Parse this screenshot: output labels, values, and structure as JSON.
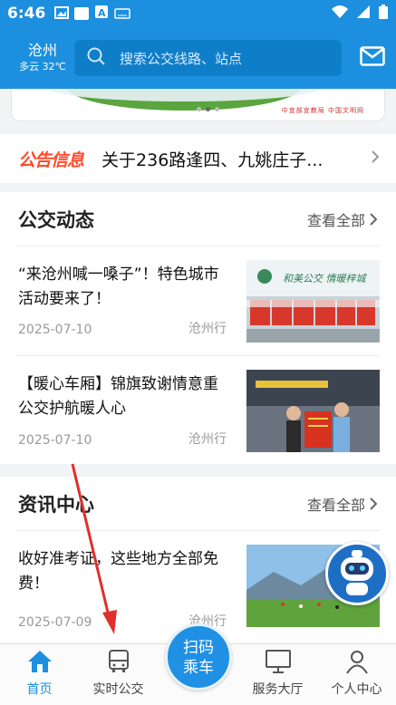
{
  "status_bar": {
    "time": "6:46"
  },
  "header": {
    "city": "沧州",
    "weather": "多云 32℃",
    "search_placeholder": "搜索公交线路、站点"
  },
  "banner": {
    "credits": "中宣部宣教局  中国文明网"
  },
  "notice": {
    "tag": "公告信息",
    "text": "关于236路逢四、九姚庄子..."
  },
  "bus_news": {
    "title": "公交动态",
    "more": "查看全部",
    "items": [
      {
        "title": "“来沧州喊一嗓子”！特色城市活动要来了！",
        "date": "2025-07-10",
        "source": "沧州行",
        "thumb_caption": "和美公交 情暖梓城"
      },
      {
        "title": "【暖心车厢】锦旗致谢情意重 公交护航暖人心",
        "date": "2025-07-10",
        "source": "沧州行"
      }
    ]
  },
  "info_center": {
    "title": "资讯中心",
    "more": "查看全部",
    "items": [
      {
        "title": "收好准考证，这些地方全部免费！",
        "date": "2025-07-09",
        "source": "沧州行"
      }
    ]
  },
  "bottom_nav": {
    "items": [
      {
        "label": "首页",
        "icon": "home-icon"
      },
      {
        "label": "实时公交",
        "icon": "bus-icon"
      },
      {
        "label": "服务大厅",
        "icon": "monitor-icon"
      },
      {
        "label": "个人中心",
        "icon": "user-icon"
      }
    ],
    "scan_line1": "扫码",
    "scan_line2": "乘车"
  },
  "colors": {
    "brand": "#1c8fdf",
    "notice_tag": "#ff4a2c",
    "annotation_arrow": "#e0302c"
  }
}
